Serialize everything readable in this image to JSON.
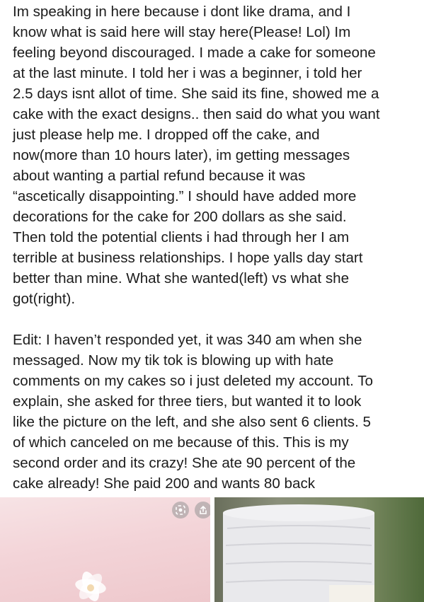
{
  "post": {
    "paragraphs": [
      "Im speaking in here because i dont like drama, and I\nknow what is said here will stay here(Please! Lol) Im\nfeeling beyond discouraged. I made a cake for someone\nat the last minute. I told her i was a beginner, i told her\n2.5 days isnt allot of time. She said its fine, showed me a\ncake with the exact designs.. then said do what you want\njust please help me. I dropped off the cake, and\nnow(more than 10 hours later), im getting messages\nabout wanting a partial refund because it was\n“ascetically disappointing.” I should have added more\ndecorations for the cake for 200 dollars as she said.\nThen told the potential clients i had through her I am\nterrible at business relationships. I hope yalls day start\nbetter than mine. What she wanted(left) vs what she\ngot(right).",
      "Edit: I haven’t responded yet, it was 340 am when she\nmessaged. Now my tik tok is blowing up with hate\ncomments on my cakes so i just deleted my account. To\nexplain, she asked for three tiers, but wanted it to look\nlike the picture on the left, and she also sent 6 clients. 5\nof which canceled on me because of this. This is my\nsecond order and its crazy! She ate 90 percent of the\ncake already! She paid 200 and wants 80 back"
    ]
  },
  "media": {
    "left_photo_icons": [
      "lens-icon",
      "share-icon"
    ]
  },
  "colors": {
    "text": "#1c1c1c",
    "left_photo_bg": "#f3d4d8",
    "right_photo_bg": "#7b8a63",
    "cake_frosting": "#e9e9ec"
  }
}
